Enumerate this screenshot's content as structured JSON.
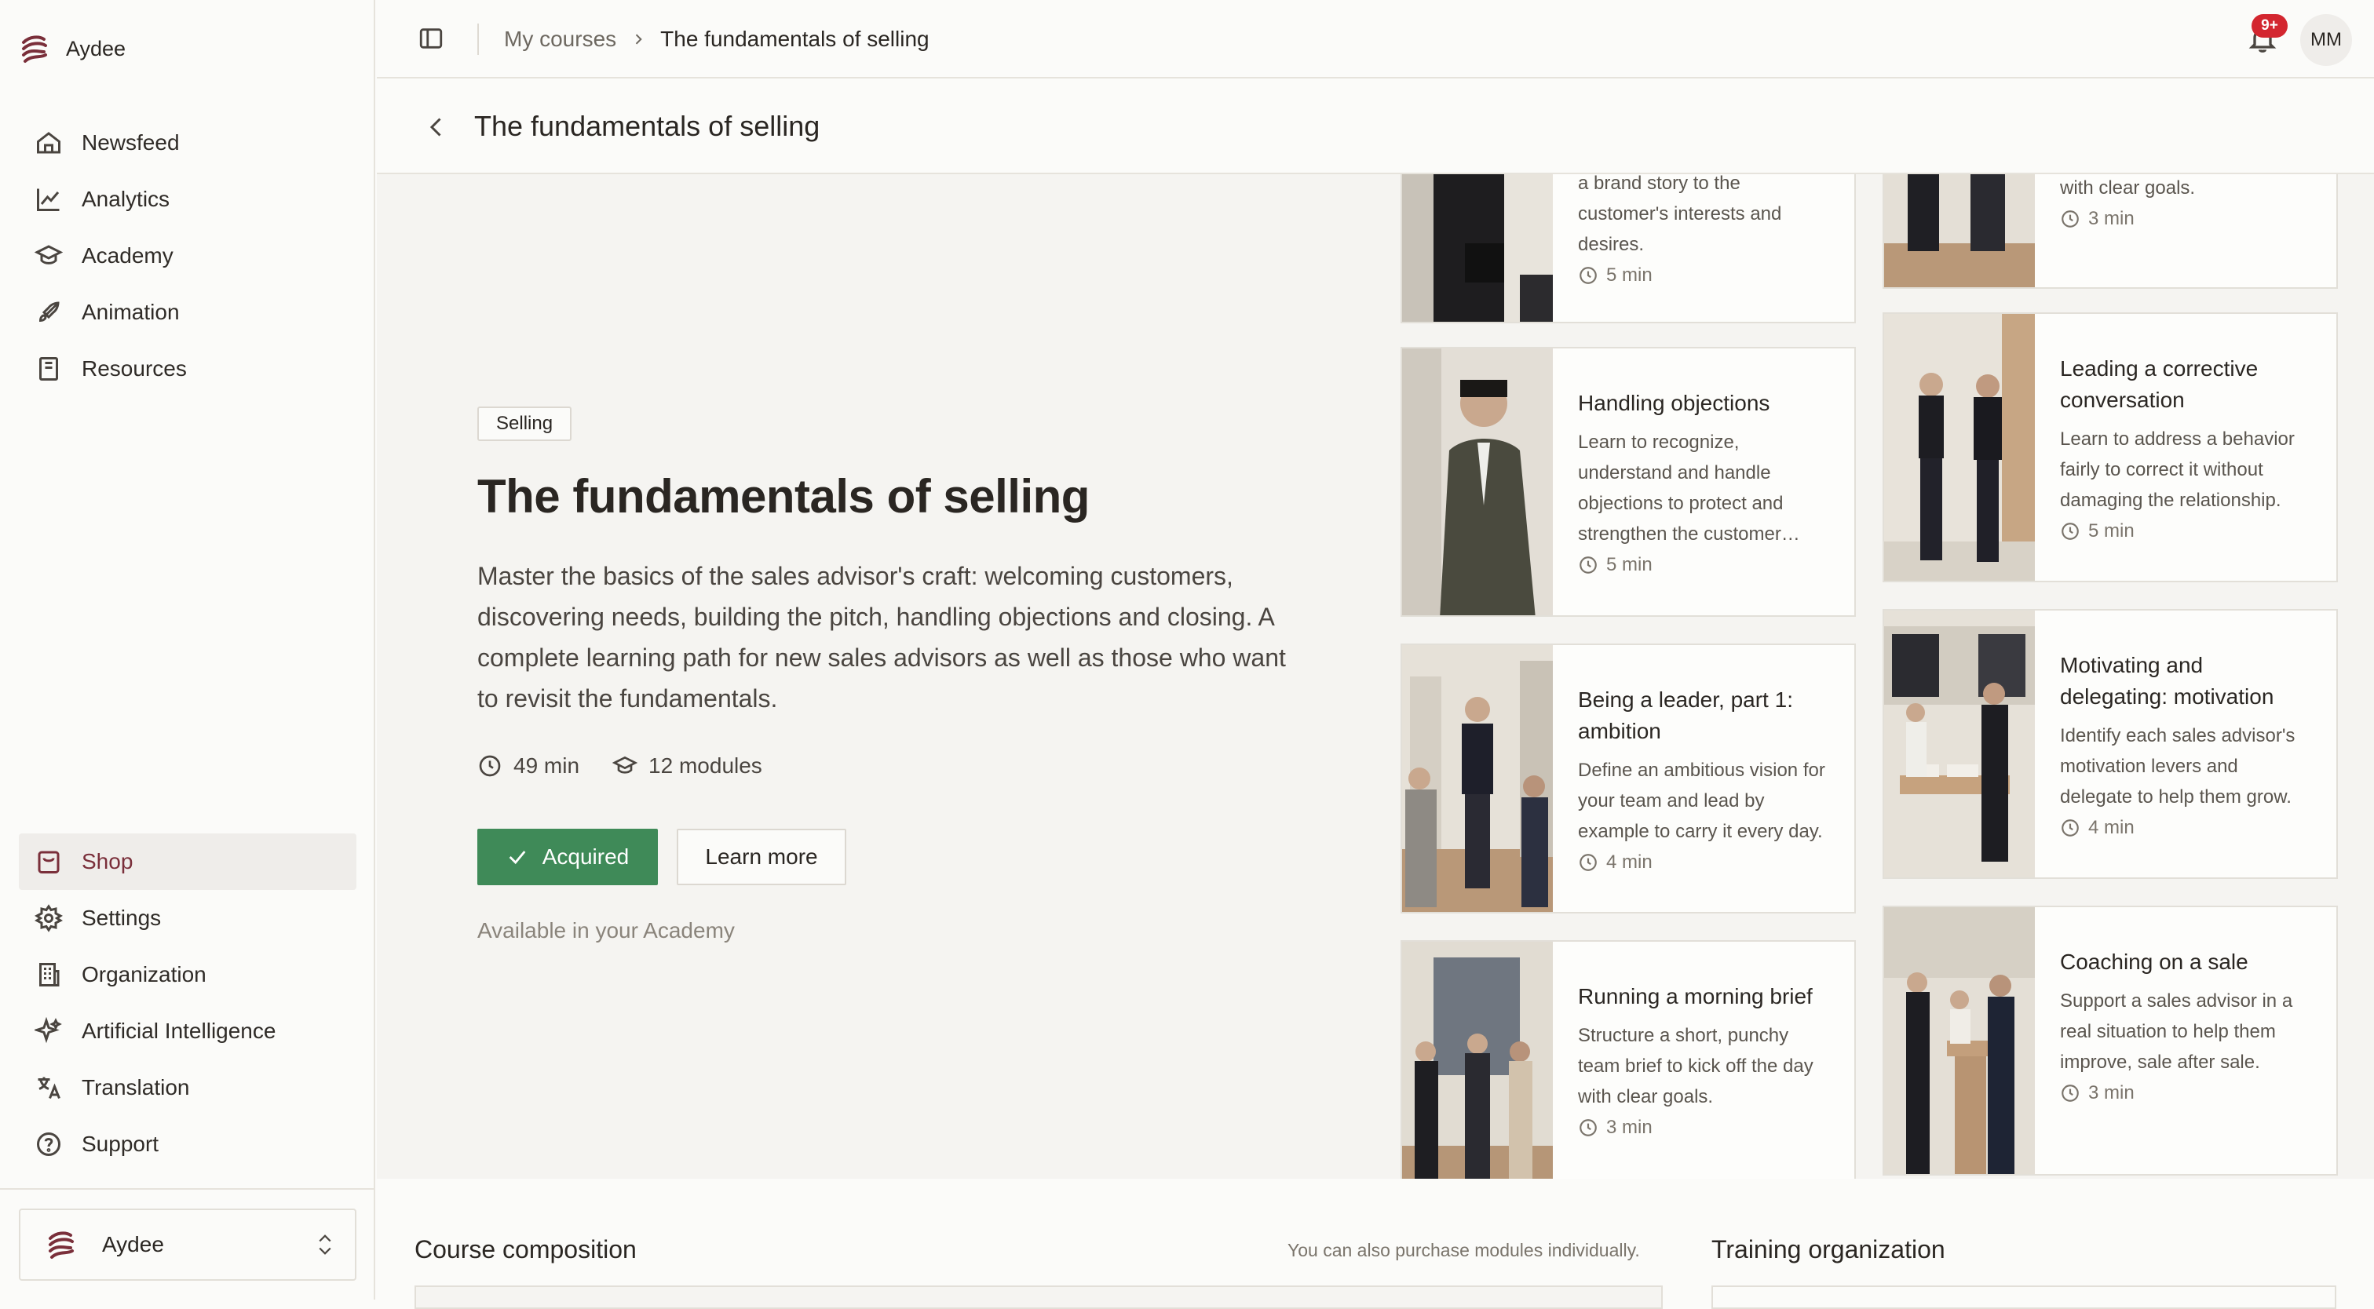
{
  "app": {
    "brand": "Aydee",
    "brand_color": "#7a2f3a",
    "accent_green": "#3f8a58"
  },
  "sidebar": {
    "top_items": [
      {
        "label": "Newsfeed",
        "icon": "home-icon"
      },
      {
        "label": "Analytics",
        "icon": "chart-line-icon"
      },
      {
        "label": "Academy",
        "icon": "graduation-cap-icon"
      },
      {
        "label": "Animation",
        "icon": "rocket-icon"
      },
      {
        "label": "Resources",
        "icon": "book-icon"
      }
    ],
    "bottom_items": [
      {
        "label": "Shop",
        "icon": "shopping-bag-icon",
        "active": true
      },
      {
        "label": "Settings",
        "icon": "gear-icon"
      },
      {
        "label": "Organization",
        "icon": "building-icon"
      },
      {
        "label": "Artificial Intelligence",
        "icon": "sparkles-icon"
      },
      {
        "label": "Translation",
        "icon": "translate-icon"
      },
      {
        "label": "Support",
        "icon": "help-circle-icon"
      }
    ],
    "org_switch": {
      "label": "Aydee"
    }
  },
  "topbar": {
    "breadcrumb_parent": "My courses",
    "breadcrumb_current": "The fundamentals of selling",
    "notification_badge": "9+",
    "avatar_initials": "MM"
  },
  "header": {
    "title": "The fundamentals of selling"
  },
  "course": {
    "tag": "Selling",
    "title": "The fundamentals of selling",
    "description": "Master the basics of the sales advisor's craft: welcoming customers, discovering needs, building the pitch, handling objections and closing. A complete learning path for new sales advisors as well as those who want to revisit the fundamentals.",
    "duration": "49 min",
    "modules": "12 modules",
    "acquired_label": "Acquired",
    "learn_more_label": "Learn more",
    "availability": "Available in your Academy"
  },
  "modules_left": [
    {
      "title": "",
      "description": "a brand story to the customer's interests and desires.",
      "duration": "5 min"
    },
    {
      "title": "Handling objections",
      "description": "Learn to recognize, understand and handle objections to protect and strengthen the customer…",
      "duration": "5 min"
    },
    {
      "title": "Being a leader, part 1: ambition",
      "description": "Define an ambitious vision for your team and lead by example to carry it every day.",
      "duration": "4 min"
    },
    {
      "title": "Running a morning brief",
      "description": "Structure a short, punchy team brief to kick off the day with clear goals.",
      "duration": "3 min"
    }
  ],
  "modules_right": [
    {
      "title": "",
      "description": "with clear goals.",
      "duration": "3 min"
    },
    {
      "title": "Leading a corrective conversation",
      "description": "Learn to address a behavior fairly to correct it without damaging the relationship.",
      "duration": "5 min"
    },
    {
      "title": "Motivating and delegating: motivation",
      "description": "Identify each sales advisor's motivation levers and delegate to help them grow.",
      "duration": "4 min"
    },
    {
      "title": "Coaching on a sale",
      "description": "Support a sales advisor in a real situation to help them improve, sale after sale.",
      "duration": "3 min"
    }
  ],
  "bottom": {
    "composition_title": "Course composition",
    "composition_note": "You can also purchase modules individually.",
    "training_org_title": "Training organization"
  }
}
